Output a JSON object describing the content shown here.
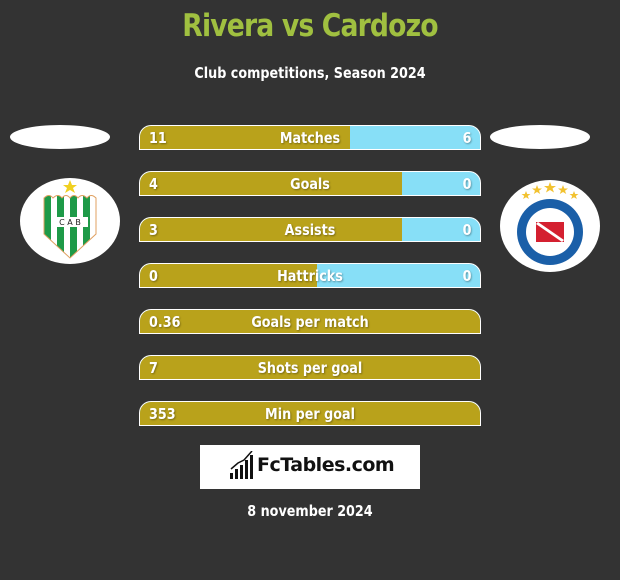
{
  "header": {
    "title": "Rivera vs Cardozo",
    "subtitle": "Club competitions, Season 2024"
  },
  "players": {
    "left": {
      "name": "Rivera",
      "club_badge": "banfield-crest",
      "club_initials": "C A B"
    },
    "right": {
      "name": "Cardozo",
      "club_badge": "argentinos-juniors-crest"
    }
  },
  "colors": {
    "left_bar": "#b9a21b",
    "right_bar": "#87dff7",
    "title": "#a0c040",
    "background": "#333333"
  },
  "stats": [
    {
      "label": "Matches",
      "left": "11",
      "right": "6",
      "left_share": 0.617
    },
    {
      "label": "Goals",
      "left": "4",
      "right": "0",
      "left_share": 0.77
    },
    {
      "label": "Assists",
      "left": "3",
      "right": "0",
      "left_share": 0.77
    },
    {
      "label": "Hattricks",
      "left": "0",
      "right": "0",
      "left_share": 0.52
    },
    {
      "label": "Goals per match",
      "left": "0.36",
      "right": "",
      "left_share": 1.0
    },
    {
      "label": "Shots per goal",
      "left": "7",
      "right": "",
      "left_share": 1.0
    },
    {
      "label": "Min per goal",
      "left": "353",
      "right": "",
      "left_share": 1.0
    }
  ],
  "footer": {
    "logo_text": "FcTables.com",
    "logo_icon": "bar-chart-icon",
    "date": "8 november 2024"
  }
}
